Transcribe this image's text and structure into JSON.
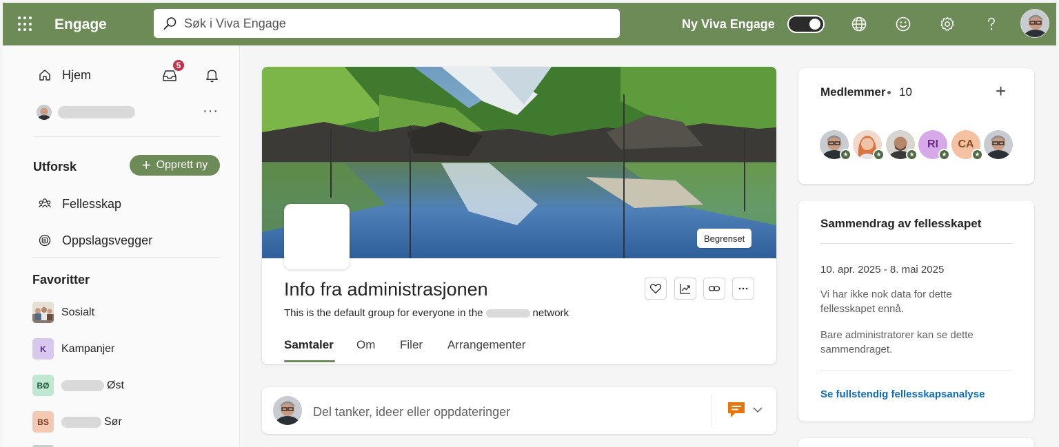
{
  "app": {
    "title": "Engage",
    "search_placeholder": "Søk i Viva Engage",
    "new_viva_label": "Ny Viva Engage",
    "toggle_on": true,
    "accent_color": "#6d8b57"
  },
  "topbar_icons": [
    "waffle-icon",
    "globe-icon",
    "smiley-icon",
    "gear-icon",
    "help-icon"
  ],
  "nav": {
    "home_label": "Hjem",
    "inbox_badge": "5",
    "explore_title": "Utforsk",
    "create_label": "Opprett ny",
    "communities_label": "Fellesskap",
    "storylines_label": "Oppslagsvegger",
    "favorites_title": "Favoritter",
    "favorites": [
      {
        "label": "Sosialt",
        "initials": "",
        "bg": "#d9d2c6",
        "fg": "#333"
      },
      {
        "label": "Kampanjer",
        "initials": "K",
        "bg": "#d8c8ee",
        "fg": "#5b2c8a"
      },
      {
        "label": "Øst",
        "initials": "BØ",
        "bg": "#bfe7d2",
        "fg": "#1e5a3a"
      },
      {
        "label": "Sør",
        "initials": "BS",
        "bg": "#f3c9b3",
        "fg": "#7a3a1c"
      }
    ]
  },
  "group": {
    "title": "Info fra administrasjonen",
    "desc_pre": "This is the default group for everyone in the",
    "desc_post": "network",
    "restricted_label": "Begrenset",
    "tabs": [
      "Samtaler",
      "Om",
      "Filer",
      "Arrangementer"
    ],
    "active_tab": "Samtaler"
  },
  "composer": {
    "placeholder": "Del tanker, ideer eller oppdateringer"
  },
  "members": {
    "title": "Medlemmer",
    "count": "10",
    "avatars": [
      {
        "initials": "",
        "bg": "#b9bfc6"
      },
      {
        "initials": "",
        "bg": "#e8a07a"
      },
      {
        "initials": "",
        "bg": "#9c8d80"
      },
      {
        "initials": "RI",
        "bg": "#d7a9e8",
        "fg": "#6b2a85"
      },
      {
        "initials": "CA",
        "bg": "#f4c2a2",
        "fg": "#8a4a22"
      },
      {
        "initials": "",
        "bg": "#b9bfc6"
      }
    ]
  },
  "summary": {
    "title": "Sammendrag av fellesskapet",
    "date_range": "10. apr. 2025 - 8. mai 2025",
    "no_data": "Vi har ikke nok data for dette fellesskapet ennå.",
    "admin_only": "Bare administratorer kan se dette sammendraget.",
    "link": "Se fullstendig fellesskapsanalyse"
  }
}
